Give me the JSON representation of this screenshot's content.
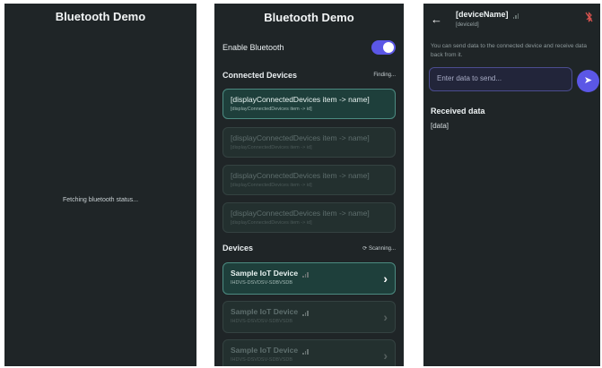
{
  "screen1": {
    "title": "Bluetooth Demo",
    "status": "Fetching bluetooth status..."
  },
  "screen2": {
    "title": "Bluetooth Demo",
    "enable_label": "Enable Bluetooth",
    "enable_on": true,
    "connected_title": "Connected Devices",
    "connected_status": "Finding...",
    "connected_items": [
      {
        "name": "[displayConnectedDevices item -> name]",
        "id": "[displayConnectedDevices item -> id]"
      },
      {
        "name": "[displayConnectedDevices item -> name]",
        "id": "[displayConnectedDevices item -> id]"
      },
      {
        "name": "[displayConnectedDevices item -> name]",
        "id": "[displayConnectedDevices item -> id]"
      },
      {
        "name": "[displayConnectedDevices item -> name]",
        "id": "[displayConnectedDevices item -> id]"
      }
    ],
    "devices_title": "Devices",
    "devices_status": "Scanning...",
    "devices": [
      {
        "name": "Sample IoT Device",
        "id": "IHDVS-DSVDSV-SDBVSDB"
      },
      {
        "name": "Sample IoT Device",
        "id": "IHDVS-DSVDSV-SDBVSDB"
      },
      {
        "name": "Sample IoT Device",
        "id": "IHDVS-DSVDSV-SDBVSDB"
      }
    ]
  },
  "screen3": {
    "device_name": "[deviceName]",
    "device_id": "[deviceId]",
    "description": "You can send data to the connected device and receive data back from it.",
    "input_placeholder": "Enter data to send...",
    "received_title": "Received data",
    "received_value": "[data]",
    "icons": {
      "back": "back-arrow-icon",
      "disconnect": "bluetooth-off-icon",
      "send": "send-icon"
    }
  }
}
